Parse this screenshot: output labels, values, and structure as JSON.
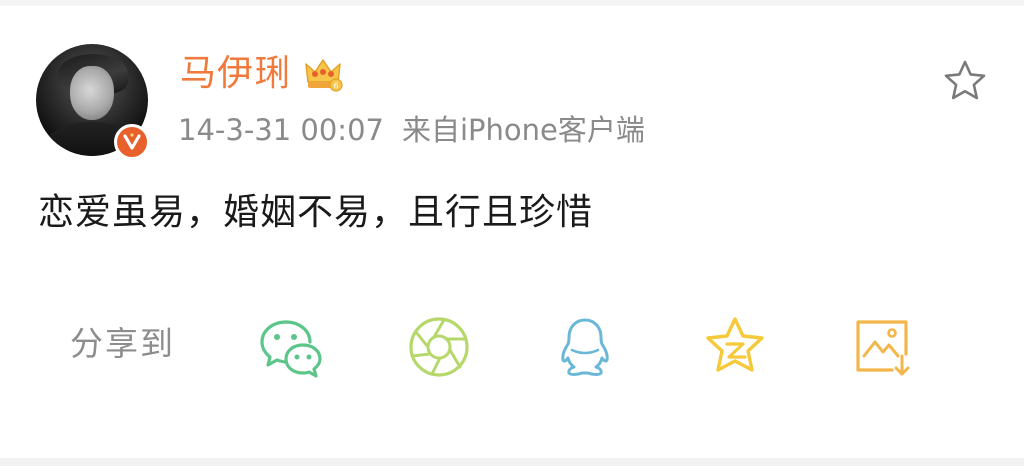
{
  "post": {
    "username": "马伊琍",
    "timestamp": "14-3-31 00:07",
    "source": "来自iPhone客户端",
    "text": "恋爱虽易，婚姻不易，且行且珍惜"
  },
  "share": {
    "label": "分享到",
    "targets": [
      {
        "icon": "wechat-icon",
        "color": "#5cc68a"
      },
      {
        "icon": "wechat-moments-icon",
        "color": "#b6d86a"
      },
      {
        "icon": "qq-icon",
        "color": "#6ab7d8"
      },
      {
        "icon": "qzone-icon",
        "color": "#f5c93a"
      },
      {
        "icon": "save-image-icon",
        "color": "#f2b64a"
      }
    ]
  },
  "icons": {
    "favorite": "star-outline-icon",
    "membership": "crown-vip-icon",
    "verified": "verified-v-icon"
  },
  "colors": {
    "username": "#f07a3c",
    "meta": "#8a8a8a",
    "body_text": "#1a1a1a",
    "verified_badge": "#e8612c"
  }
}
